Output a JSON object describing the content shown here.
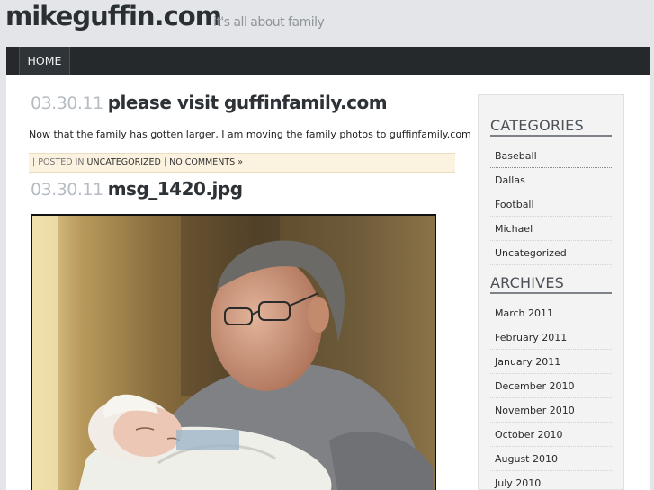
{
  "site": {
    "title": "mikeguffin.com",
    "tagline": "it's all about family"
  },
  "nav": {
    "items": [
      {
        "label": "HOME"
      }
    ]
  },
  "posts": [
    {
      "date": "03.30.11",
      "title": "please visit guffinfamily.com",
      "body": "Now that the family has gotten larger, I am moving the family photos to guffinfamily.com",
      "meta": {
        "posted_in_prefix": "| POSTED IN",
        "category": "UNCATEGORIZED",
        "separator": "|",
        "comments": "NO COMMENTS »"
      }
    },
    {
      "date": "03.30.11",
      "title": "msg_1420.jpg",
      "image_subject": "grandfather holding newborn baby"
    }
  ],
  "sidebar": {
    "categories": {
      "title": "CATEGORIES",
      "items": [
        "Baseball",
        "Dallas",
        "Football",
        "Michael",
        "Uncategorized"
      ]
    },
    "archives": {
      "title": "ARCHIVES",
      "items": [
        "March 2011",
        "February 2011",
        "January 2011",
        "December 2010",
        "November 2010",
        "October 2010",
        "August 2010",
        "July 2010"
      ]
    }
  }
}
